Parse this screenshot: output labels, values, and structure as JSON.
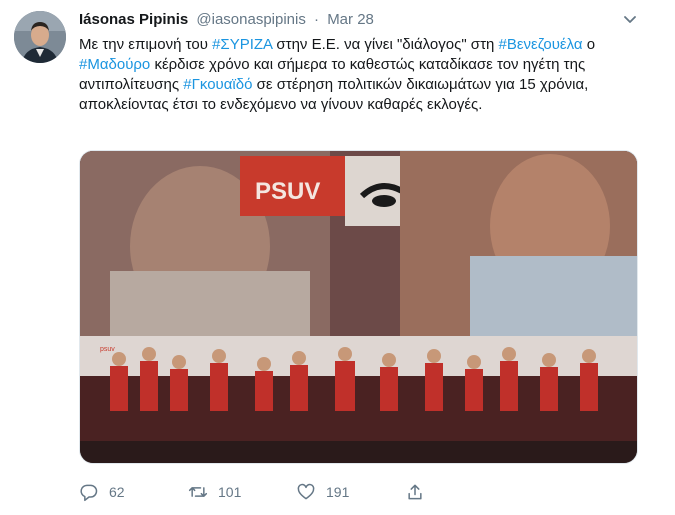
{
  "tweet": {
    "name": "Iásonas Pipinis",
    "handle": "@iasonaspipinis",
    "separator": "·",
    "time": "Mar 28",
    "text_segments": [
      {
        "text": "Με την επιμονή του ",
        "hashtag": false
      },
      {
        "text": "#ΣΥΡΙΖΑ",
        "hashtag": true
      },
      {
        "text": " στην Ε.Ε. να γίνει \"διάλογος\" στη ",
        "hashtag": false
      },
      {
        "text": "#Βενεζουέλα",
        "hashtag": true
      },
      {
        "text": " ο ",
        "hashtag": false
      },
      {
        "text": "#Μαδούρο",
        "hashtag": true
      },
      {
        "text": " κέρδισε χρόνο και σήμερα το καθεστώς καταδίκασε τον ηγέτη της αντιπολίτευσης ",
        "hashtag": false
      },
      {
        "text": "#Γκουαϊδό",
        "hashtag": true
      },
      {
        "text": " σε στέρηση πολιτικών δικαιωμάτων για 15 χρόνια, αποκλείοντας έτσι το ενδεχόμενο να γίνουν καθαρές εκλογές.",
        "hashtag": false
      }
    ],
    "media": {
      "banner_logo_text": "PSUV",
      "podium_label_text": "psuv"
    },
    "actions": {
      "reply_count": "62",
      "retweet_count": "101",
      "like_count": "191"
    },
    "icons": [
      "caret-down-icon",
      "reply-icon",
      "retweet-icon",
      "like-icon",
      "share-icon"
    ],
    "colors": {
      "hashtag": "#1b95e0",
      "meta": "#657786",
      "text": "#14171a"
    }
  }
}
